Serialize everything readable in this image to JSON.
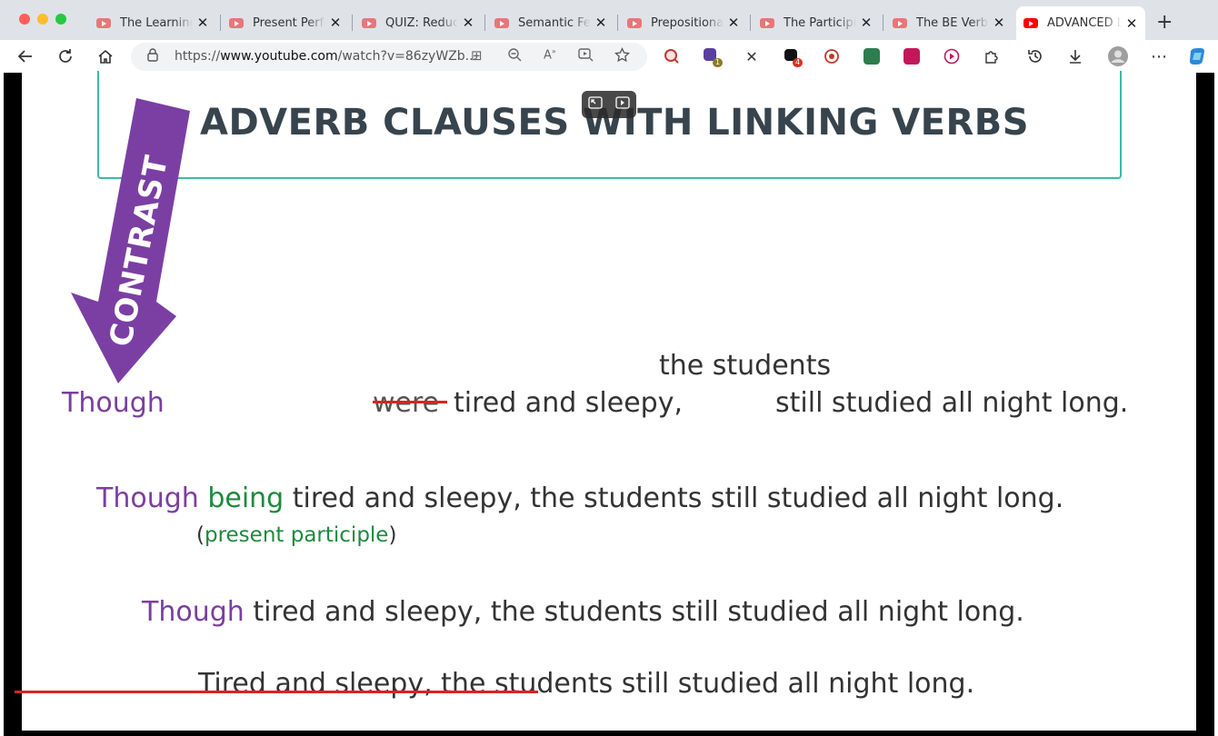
{
  "tabs": [
    {
      "label": "The Learning Li",
      "active": false
    },
    {
      "label": "Present Perfect",
      "active": false
    },
    {
      "label": "QUIZ: Reduced",
      "active": false
    },
    {
      "label": "Semantic Featu",
      "active": false
    },
    {
      "label": "Prepositional P",
      "active": false
    },
    {
      "label": "The Participial",
      "active": false
    },
    {
      "label": "The BE Verb: E",
      "active": false
    },
    {
      "label": "ADVANCED LE",
      "active": true
    }
  ],
  "address": {
    "prefix": "https://",
    "domain": "www.youtube.com",
    "path": "/watch?v=86zyWZb..."
  },
  "extensions": {
    "badge1": "1",
    "badge2": "4"
  },
  "slide": {
    "title": "ADVERB CLAUSES WITH LINKING VERBS",
    "arrow_label": "CONTRAST",
    "row1": {
      "though": "Though",
      "subject_above": "the students",
      "struck_verb": "were",
      "clause": "tired and sleepy,",
      "main": "still studied all night long."
    },
    "row2": {
      "though": "Though",
      "being": "being",
      "rest": "tired and sleepy, the students still studied all night long.",
      "note_open": "(",
      "note": "present participle",
      "note_close": ")"
    },
    "row3": {
      "though": "Though",
      "rest": "tired and sleepy, the students still studied all night long."
    },
    "row4": {
      "text": "Tired and sleepy, the students still studied all night long."
    }
  },
  "colors": {
    "accent_purple": "#7a3fa0",
    "participle_green": "#1e8a3c",
    "strike_red": "#e02020",
    "title_border": "#3fb8a8"
  }
}
